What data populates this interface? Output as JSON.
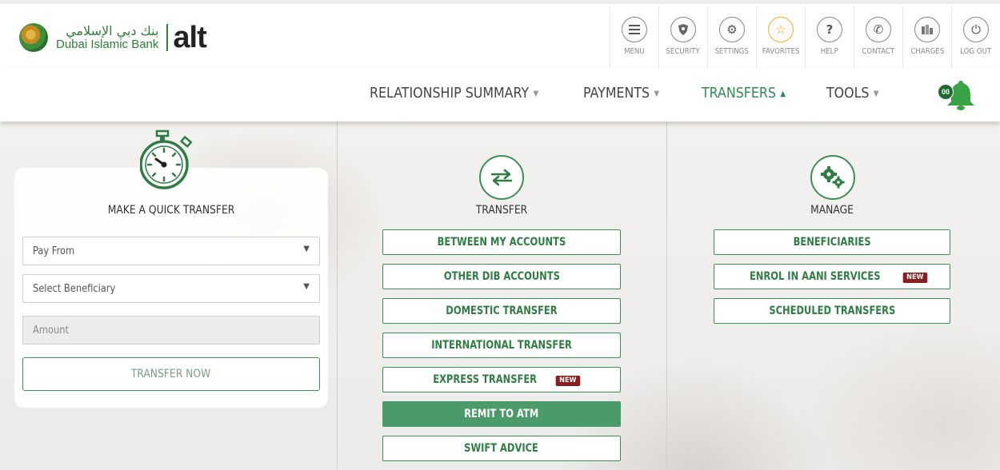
{
  "brand": {
    "arabic_name": "بنك دبي الإسلامي",
    "english_name": "Dubai Islamic Bank",
    "product": "alt",
    "accent_color": "#2f7d45",
    "highlight_color": "#f4a11b"
  },
  "utility_nav": [
    {
      "label": "MENU",
      "icon": "menu-icon"
    },
    {
      "label": "SECURITY",
      "icon": "shield-icon"
    },
    {
      "label": "SETTINGS",
      "icon": "gear-icon"
    },
    {
      "label": "FAVORITES",
      "icon": "star-icon"
    },
    {
      "label": "HELP",
      "icon": "question-icon"
    },
    {
      "label": "CONTACT",
      "icon": "phone-icon"
    },
    {
      "label": "CHARGES",
      "icon": "charges-icon"
    },
    {
      "label": "LOG OUT",
      "icon": "power-icon"
    }
  ],
  "main_nav": [
    {
      "label": "RELATIONSHIP SUMMARY",
      "active": false
    },
    {
      "label": "PAYMENTS",
      "active": false
    },
    {
      "label": "TRANSFERS",
      "active": true
    },
    {
      "label": "TOOLS",
      "active": false
    }
  ],
  "notifications": {
    "count": "00"
  },
  "quick_transfer": {
    "title": "MAKE A QUICK TRANSFER",
    "pay_from": "Pay From",
    "beneficiary": "Select Beneficiary",
    "amount_placeholder": "Amount",
    "submit_label": "TRANSFER NOW"
  },
  "transfer": {
    "title": "TRANSFER",
    "options": [
      {
        "label": "BETWEEN MY ACCOUNTS",
        "badge": "",
        "active": false
      },
      {
        "label": "OTHER DIB ACCOUNTS",
        "badge": "",
        "active": false
      },
      {
        "label": "DOMESTIC TRANSFER",
        "badge": "",
        "active": false
      },
      {
        "label": "INTERNATIONAL TRANSFER",
        "badge": "",
        "active": false
      },
      {
        "label": "EXPRESS TRANSFER",
        "badge": "NEW",
        "active": false
      },
      {
        "label": "REMIT TO ATM",
        "badge": "",
        "active": true
      },
      {
        "label": "SWIFT ADVICE",
        "badge": "",
        "active": false
      }
    ]
  },
  "manage": {
    "title": "MANAGE",
    "options": [
      {
        "label": "BENEFICIARIES",
        "badge": ""
      },
      {
        "label": "ENROL IN AANI SERVICES",
        "badge": "NEW"
      },
      {
        "label": "SCHEDULED TRANSFERS",
        "badge": ""
      }
    ]
  }
}
